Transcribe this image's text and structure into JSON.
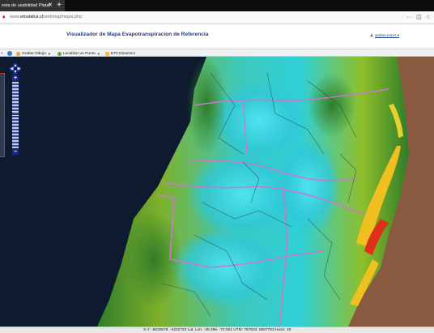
{
  "browser": {
    "tab_title": "esta de usabilidad Plataf",
    "close_glyph": "✕",
    "new_tab_glyph": "+",
    "url_prefix": "www.",
    "url_host": "etoutalca.cl",
    "url_path": "/webmap/mapa.php",
    "more_glyph": "···",
    "pocket_glyph": "◫",
    "star_glyph": "☆",
    "icons": [
      "site-info-icon",
      "page-actions-icon",
      "pocket-icon",
      "bookmark-star-icon"
    ]
  },
  "header": {
    "title": "Visualizador de Mapa Evapotranspiracion de Referencia",
    "user_icon": "♟",
    "user_name": "andres.torres ▾"
  },
  "toolbar": {
    "items": [
      {
        "label": "Grabar Dibujo",
        "icon": "save-drawing-icon",
        "color": "#e8a040"
      },
      {
        "label": "Localizar un Punto",
        "icon": "locate-point-icon",
        "color": "#6aa84f"
      },
      {
        "label": "ET0 Dinamico",
        "icon": "folder-icon",
        "color": "#f0c050"
      }
    ],
    "caret": "▼"
  },
  "map": {
    "zoom_in": "+",
    "zoom_out": "−",
    "pan_up": "▲",
    "pan_down": "▼",
    "pan_left": "◀",
    "pan_right": "▶",
    "zoom_level": 10,
    "max_zoom": 20,
    "colors": {
      "ocean": "#0b1424",
      "land_dry": "#2f7d2a",
      "land_mid": "#8fbf2a",
      "land_wet": "#2fd0d8",
      "land_high": "#f0c020",
      "land_peak": "#e0301a",
      "mountains": "#8a5a40",
      "boundaries": "#c87ac8"
    }
  },
  "status_bar": {
    "text": "X,Y: -8020678, -4231723  Lat, Lon: -35.498, -72.051  UTM: 767503, 6067763  Huso: 18"
  }
}
